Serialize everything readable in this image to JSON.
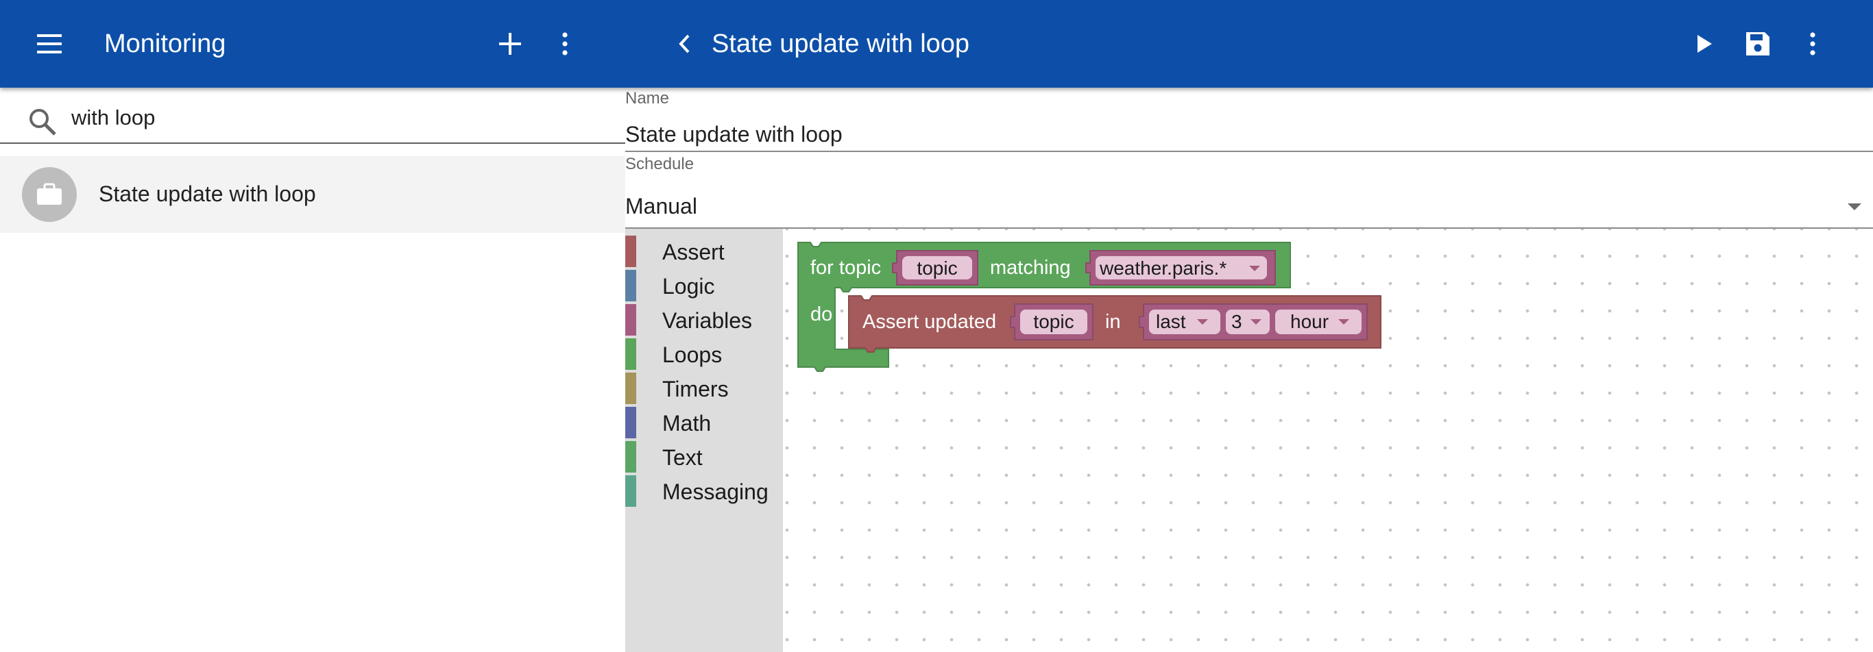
{
  "appbar": {
    "title": "Monitoring",
    "script_title": "State update with loop",
    "icons": {
      "menu": "hamburger-icon",
      "add": "plus-icon",
      "more": "vertical-dots-icon",
      "back": "chevron-left-icon",
      "run": "play-icon",
      "save": "floppy-disk-icon",
      "more_right": "vertical-dots-icon"
    }
  },
  "search": {
    "value": "with loop",
    "icon": "search-icon"
  },
  "list": {
    "items": [
      {
        "label": "State update with loop",
        "icon": "briefcase-icon"
      }
    ]
  },
  "form": {
    "name_label": "Name",
    "name_value": "State update with loop",
    "schedule_label": "Schedule",
    "schedule_value": "Manual"
  },
  "toolbox": {
    "categories": [
      {
        "label": "Assert",
        "color": "#a55b5b"
      },
      {
        "label": "Logic",
        "color": "#5b80a5"
      },
      {
        "label": "Variables",
        "color": "#a55b80"
      },
      {
        "label": "Loops",
        "color": "#5ba55b"
      },
      {
        "label": "Timers",
        "color": "#a5955b"
      },
      {
        "label": "Math",
        "color": "#5b67a5"
      },
      {
        "label": "Text",
        "color": "#5ba565"
      },
      {
        "label": "Messaging",
        "color": "#5ba58c"
      }
    ]
  },
  "blocks": {
    "loop": {
      "label_for": "for topic",
      "var": "topic",
      "label_matching": "matching",
      "pattern": "weather.paris.*",
      "label_do": "do",
      "color": "#5ba55b"
    },
    "assert": {
      "label": "Assert updated",
      "var": "topic",
      "label_in": "in",
      "period": "last",
      "amount": "3",
      "unit": "hour",
      "color": "#a55b5b"
    }
  },
  "colors": {
    "appbar": "#0d4fa8",
    "variable_pill": "#a55b80",
    "toolbox_bg": "#dddddd"
  }
}
